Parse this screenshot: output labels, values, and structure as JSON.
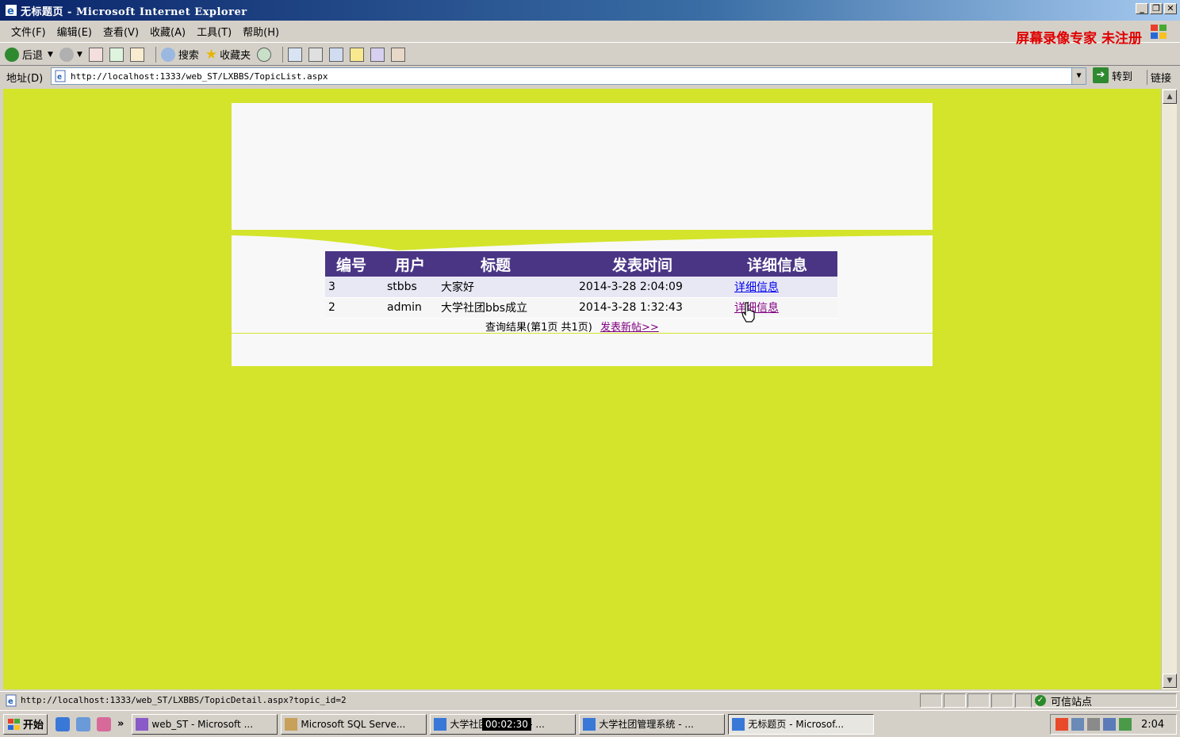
{
  "window": {
    "title": "无标题页 - Microsoft Internet Explorer",
    "controls": {
      "minimize": "_",
      "restore": "❐",
      "close": "✕"
    }
  },
  "menu": {
    "items": [
      "文件(F)",
      "编辑(E)",
      "查看(V)",
      "收藏(A)",
      "工具(T)",
      "帮助(H)"
    ],
    "watermark": "屏幕录像专家 未注册"
  },
  "toolbar": {
    "back_label": "后退",
    "search_label": "搜索",
    "favorites_label": "收藏夹"
  },
  "address": {
    "label": "地址(D)",
    "url": "http://localhost:1333/web_ST/LXBBS/TopicList.aspx",
    "go_label": "转到",
    "links_label": "链接"
  },
  "topics": {
    "headers": [
      "编号",
      "用户",
      "标题",
      "发表时间",
      "详细信息"
    ],
    "rows": [
      {
        "id": "3",
        "user": "stbbs",
        "title": "大家好",
        "time": "2014-3-28 2:04:09",
        "detail": "详细信息"
      },
      {
        "id": "2",
        "user": "admin",
        "title": "大学社团bbs成立",
        "time": "2014-3-28 1:32:43",
        "detail": "详细信息"
      }
    ],
    "pager_text": "查询结果(第1页 共1页)",
    "new_post_link": "发表新帖>>"
  },
  "status": {
    "url": "http://localhost:1333/web_ST/LXBBS/TopicDetail.aspx?topic_id=2",
    "zone": "可信站点"
  },
  "taskbar": {
    "start_label": "开始",
    "tasks": [
      {
        "label": "web_ST - Microsoft ..."
      },
      {
        "label": "Microsoft SQL Serve..."
      },
      {
        "label": "大学社团管理系统 - ..."
      },
      {
        "label": "大学社团管理系统 - ..."
      },
      {
        "label": "无标题页 - Microsof..."
      }
    ],
    "clock": "2:04",
    "recording_timer": "00:02:30"
  },
  "colors": {
    "page_background": "#d3e42b",
    "table_header": "#4a3585",
    "link": "#0000ee",
    "visited_link": "#800080"
  }
}
